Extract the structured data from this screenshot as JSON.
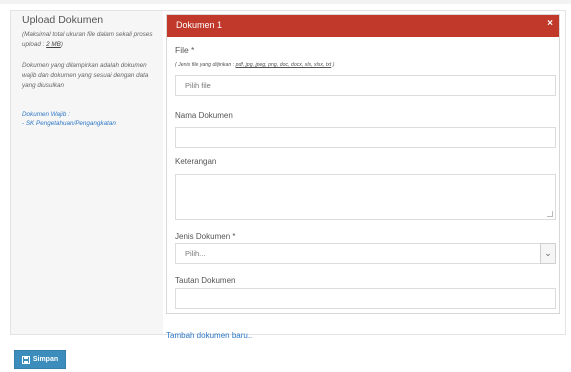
{
  "sidebar": {
    "title": "Upload Dokumen",
    "note": "(Maksimal total ukuran file dalam sekali proses upload :",
    "max_size": "2 MB",
    "note_end": ")",
    "description": "Dokumen yang dilampirkan adalah dokumen wajib dan dokumen yang sesuai dengan data yang diusulkan",
    "required_label": "Dokumen Wajib :",
    "required_items": [
      "- SK Pengetahuan/Pengangkatan"
    ]
  },
  "document": {
    "title": "Dokumen 1",
    "close_icon": "×",
    "file_label": "File *",
    "file_hint": "( Jenis file yang diijinkan :",
    "file_types": "pdf, jpg, jpeg, png, doc, docx, xls, xlsx, txt",
    "file_hint_end": ")",
    "file_placeholder": "Pilih file",
    "name_label": "Nama Dokumen",
    "name_value": "",
    "desc_label": "Keterangan",
    "desc_value": "",
    "type_label": "Jenis Dokumen *",
    "type_selected": "Pilih...",
    "link_label": "Tautan Dokumen",
    "link_value": ""
  },
  "actions": {
    "add_document": "Tambah dokumen baru..",
    "save_label": "Simpan"
  },
  "colors": {
    "header": "#c0392b",
    "link": "#2e78c7",
    "primary": "#3c8dbc"
  }
}
